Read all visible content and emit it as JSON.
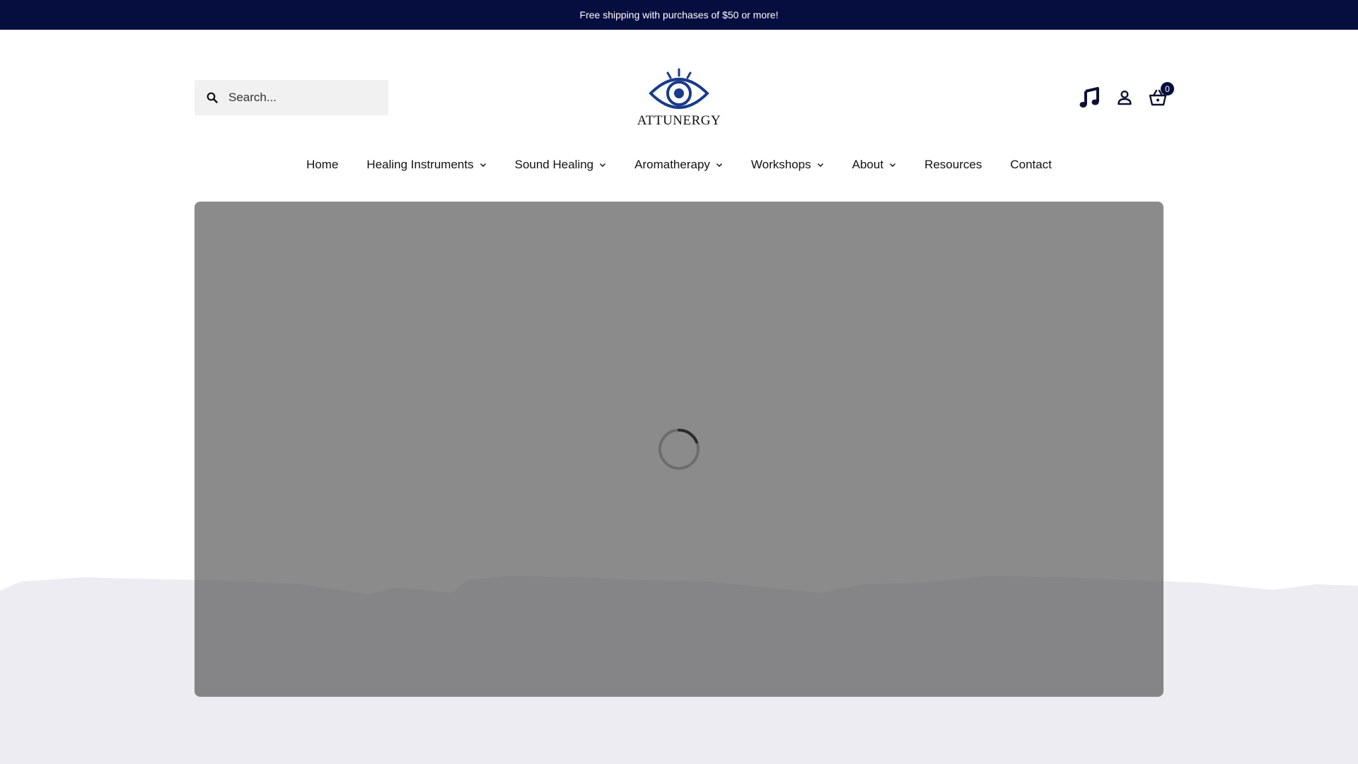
{
  "announcement": "Free shipping with purchases of $50 or more!",
  "search": {
    "placeholder": "Search..."
  },
  "logo": {
    "text": "ATTUNERGY",
    "color": "#1a3a8a"
  },
  "cart": {
    "count": "0"
  },
  "nav": {
    "items": [
      {
        "label": "Home",
        "dropdown": false
      },
      {
        "label": "Healing Instruments",
        "dropdown": true
      },
      {
        "label": "Sound Healing",
        "dropdown": true
      },
      {
        "label": "Aromatherapy",
        "dropdown": true
      },
      {
        "label": "Workshops",
        "dropdown": true
      },
      {
        "label": "About",
        "dropdown": true
      },
      {
        "label": "Resources",
        "dropdown": false
      },
      {
        "label": "Contact",
        "dropdown": false
      }
    ]
  },
  "icons": {
    "search": "search-icon",
    "music": "music-note-icon",
    "account": "user-icon",
    "cart": "basket-icon",
    "loading": "loading-spinner-icon"
  },
  "colors": {
    "announce_bg": "#060d3f",
    "hero_overlay": "#8a8a8a",
    "band": "#ececf2"
  }
}
